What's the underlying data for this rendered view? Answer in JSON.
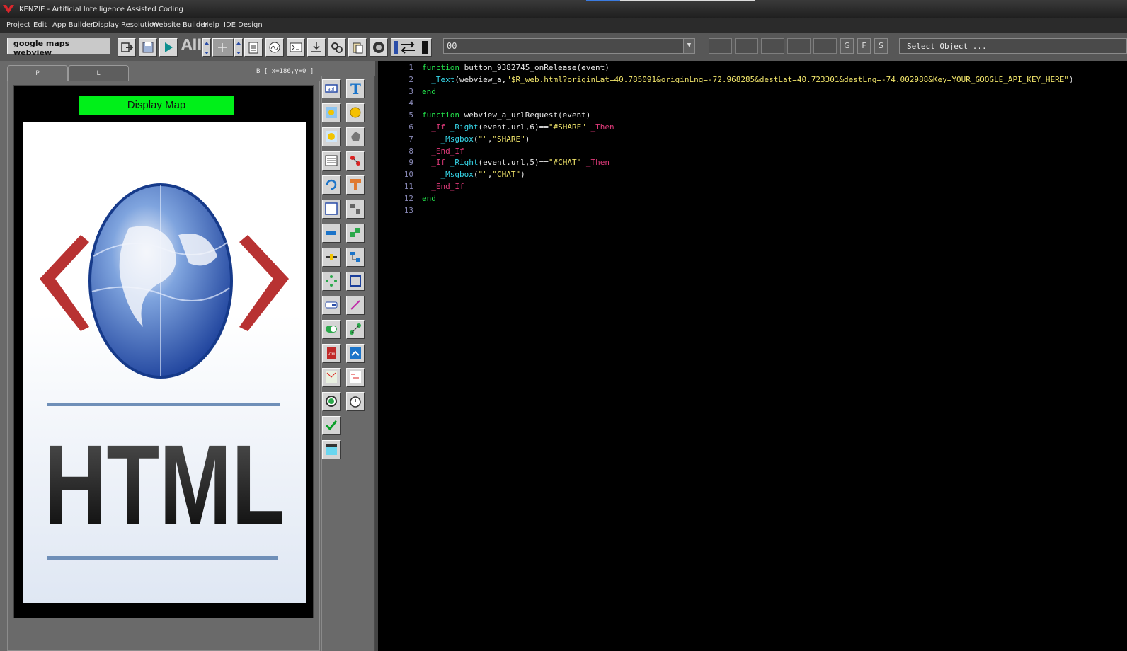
{
  "window": {
    "title": "KENZIE - Artificial Intelligence Assisted Coding"
  },
  "menu": [
    "Project",
    "Edit",
    "App Builder",
    "Display Resolution",
    "Website Builder",
    "Help",
    "IDE Design"
  ],
  "toolbar": {
    "project_name": "google maps webview",
    "all_label": "All",
    "object_combo_value": "00",
    "g_label": "G",
    "f_label": "F",
    "s_label": "S",
    "select_object": "Select Object ..."
  },
  "left_panel": {
    "tabs": [
      "P",
      "L"
    ],
    "coords": "B [ x=186,y=0 ]",
    "display_button": "Display Map",
    "webview_image_text": "HTML"
  },
  "editor": {
    "lines": [
      {
        "n": "1",
        "code": "function button_9382745_onRelease(event)"
      },
      {
        "n": "2",
        "code": "  _Text(webview_a,\"$R_web.html?originLat=40.785091&originLng=-72.968285&destLat=40.723301&destLng=-74.002988&Key=YOUR_GOOGLE_API_KEY_HERE\")"
      },
      {
        "n": "3",
        "code": "end"
      },
      {
        "n": "4",
        "code": ""
      },
      {
        "n": "5",
        "code": "function webview_a_urlRequest(event)"
      },
      {
        "n": "6",
        "code": "  _If _Right(event.url,6)==\"#SHARE\" _Then"
      },
      {
        "n": "7",
        "code": "    _Msgbox(\"\",\"SHARE\")"
      },
      {
        "n": "8",
        "code": "  _End_If"
      },
      {
        "n": "9",
        "code": "  _If _Right(event.url,5)==\"#CHAT\" _Then"
      },
      {
        "n": "10",
        "code": "    _Msgbox(\"\",\"CHAT\")"
      },
      {
        "n": "11",
        "code": "  _End_If"
      },
      {
        "n": "12",
        "code": "end"
      },
      {
        "n": "13",
        "code": ""
      }
    ],
    "colors": {
      "keyword": "#22e04a",
      "function": "#36d6e8",
      "control": "#e03a7a",
      "string": "#f0e46a"
    }
  },
  "colors": {
    "display_button": "#00f019",
    "editor_bg": "#000000"
  }
}
